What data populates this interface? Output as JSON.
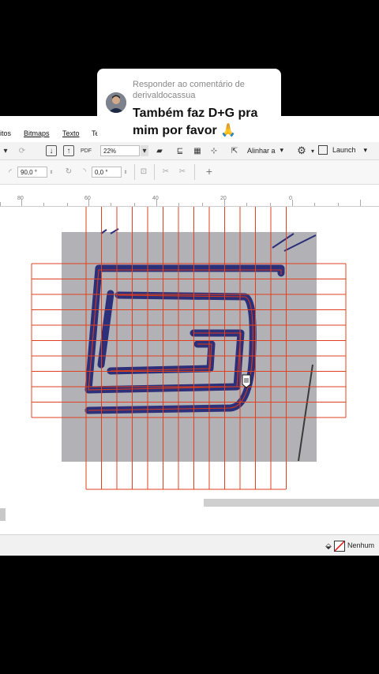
{
  "comment": {
    "reply_header": "Responder ao comentário de derivaldocassua",
    "text": "Também faz D+G pra mim por favor 🙏"
  },
  "menu": {
    "items": [
      "itos",
      "Bitmaps",
      "Texto",
      "Te"
    ]
  },
  "toolbar": {
    "zoom_value": "22%",
    "align_label": "Alinhar a",
    "launch_label": "Launch",
    "pdf_label": "PDF"
  },
  "property_bar": {
    "angle1": "90,0 °",
    "angle2": "0,0 °"
  },
  "ruler": {
    "labels": [
      "80",
      "60",
      "40",
      "20",
      "0"
    ]
  },
  "status": {
    "fill_label": "Nenhum"
  },
  "colors": {
    "grid_line": "#e0401e",
    "stroke_ink": "#2c2f7a",
    "paper": "#b2b1b5"
  }
}
